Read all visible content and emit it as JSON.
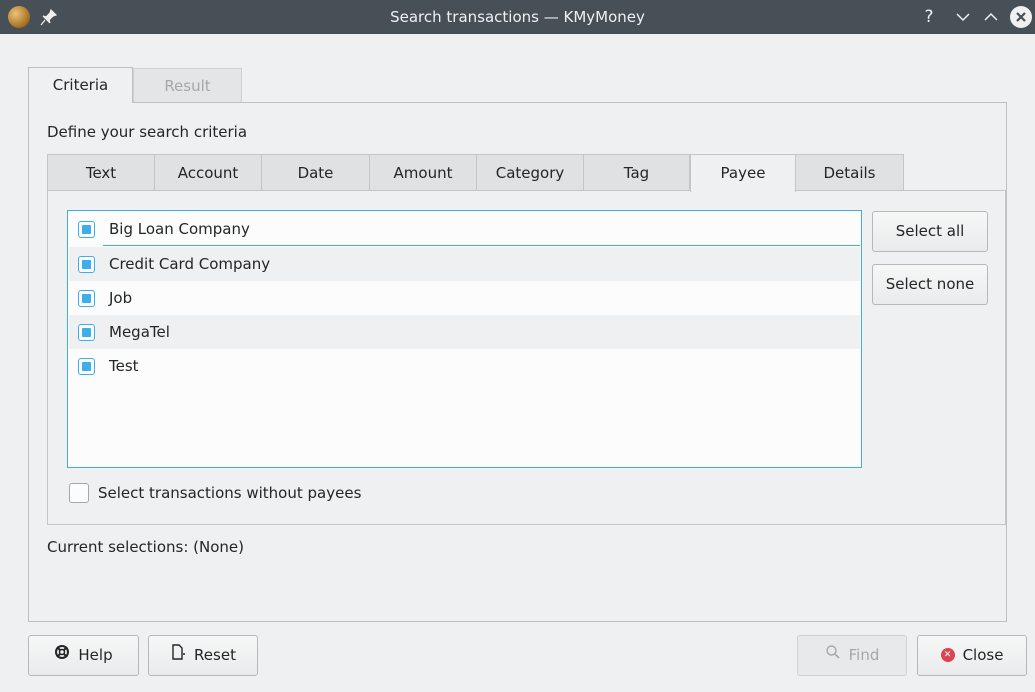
{
  "window": {
    "title": "Search transactions — KMyMoney",
    "help_glyph": "?",
    "minimize_glyph": "⌄",
    "maximize_glyph": "⌃",
    "close_glyph": "✕"
  },
  "outer_tabs": [
    {
      "label": "Criteria",
      "active": true
    },
    {
      "label": "Result",
      "active": false,
      "disabled": true
    }
  ],
  "define_label": "Define your search criteria",
  "inner_tabs": [
    {
      "label": "Text"
    },
    {
      "label": "Account"
    },
    {
      "label": "Date"
    },
    {
      "label": "Amount"
    },
    {
      "label": "Category"
    },
    {
      "label": "Tag"
    },
    {
      "label": "Payee",
      "active": true
    },
    {
      "label": "Details"
    }
  ],
  "payees": [
    {
      "name": "Big Loan Company",
      "checked": true
    },
    {
      "name": "Credit Card Company",
      "checked": true
    },
    {
      "name": "Job",
      "checked": true
    },
    {
      "name": "MegaTel",
      "checked": true
    },
    {
      "name": "Test",
      "checked": true
    }
  ],
  "buttons": {
    "select_all": "Select all",
    "select_none": "Select none",
    "help": "Help",
    "reset": "Reset",
    "find": "Find",
    "close": "Close"
  },
  "no_payee_checkbox": {
    "label": "Select transactions without payees",
    "checked": false
  },
  "current_selections": "Current selections: (None)",
  "colors": {
    "accent": "#3daee9",
    "titlebar": "#475057",
    "close_icon": "#da4453"
  }
}
